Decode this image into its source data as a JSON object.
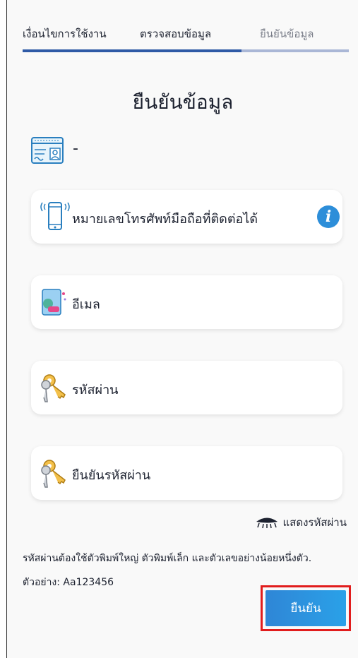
{
  "tabs": [
    {
      "label": "เงื่อนไขการใช้งาน"
    },
    {
      "label": "ตรวจสอบข้อมูล"
    },
    {
      "label": "ยืนยันข้อมูล"
    }
  ],
  "title": "ยืนยันข้อมูล",
  "id_card": {
    "value": "-"
  },
  "fields": {
    "phone": {
      "label": "หมายเลขโทรศัพท์มือถือที่ติดต่อได้"
    },
    "email": {
      "label": "อีเมล"
    },
    "password": {
      "label": "รหัสผ่าน"
    },
    "confirm_password": {
      "label": "ยืนยันรหัสผ่าน"
    }
  },
  "info_glyph": "i",
  "show_password_label": "แสดงรหัสผ่าน",
  "password_hint": "รหัสผ่านต้องใช้ตัวพิมพ์ใหญ่ ตัวพิมพ์เล็ก และตัวเลขอย่างน้อยหนึ่งตัว. ตัวอย่าง: Aa123456",
  "confirm_button": "ยืนยัน",
  "colors": {
    "accent": "#2f5aa6",
    "button": "#2a8fdd",
    "highlight": "#e11d1d"
  }
}
